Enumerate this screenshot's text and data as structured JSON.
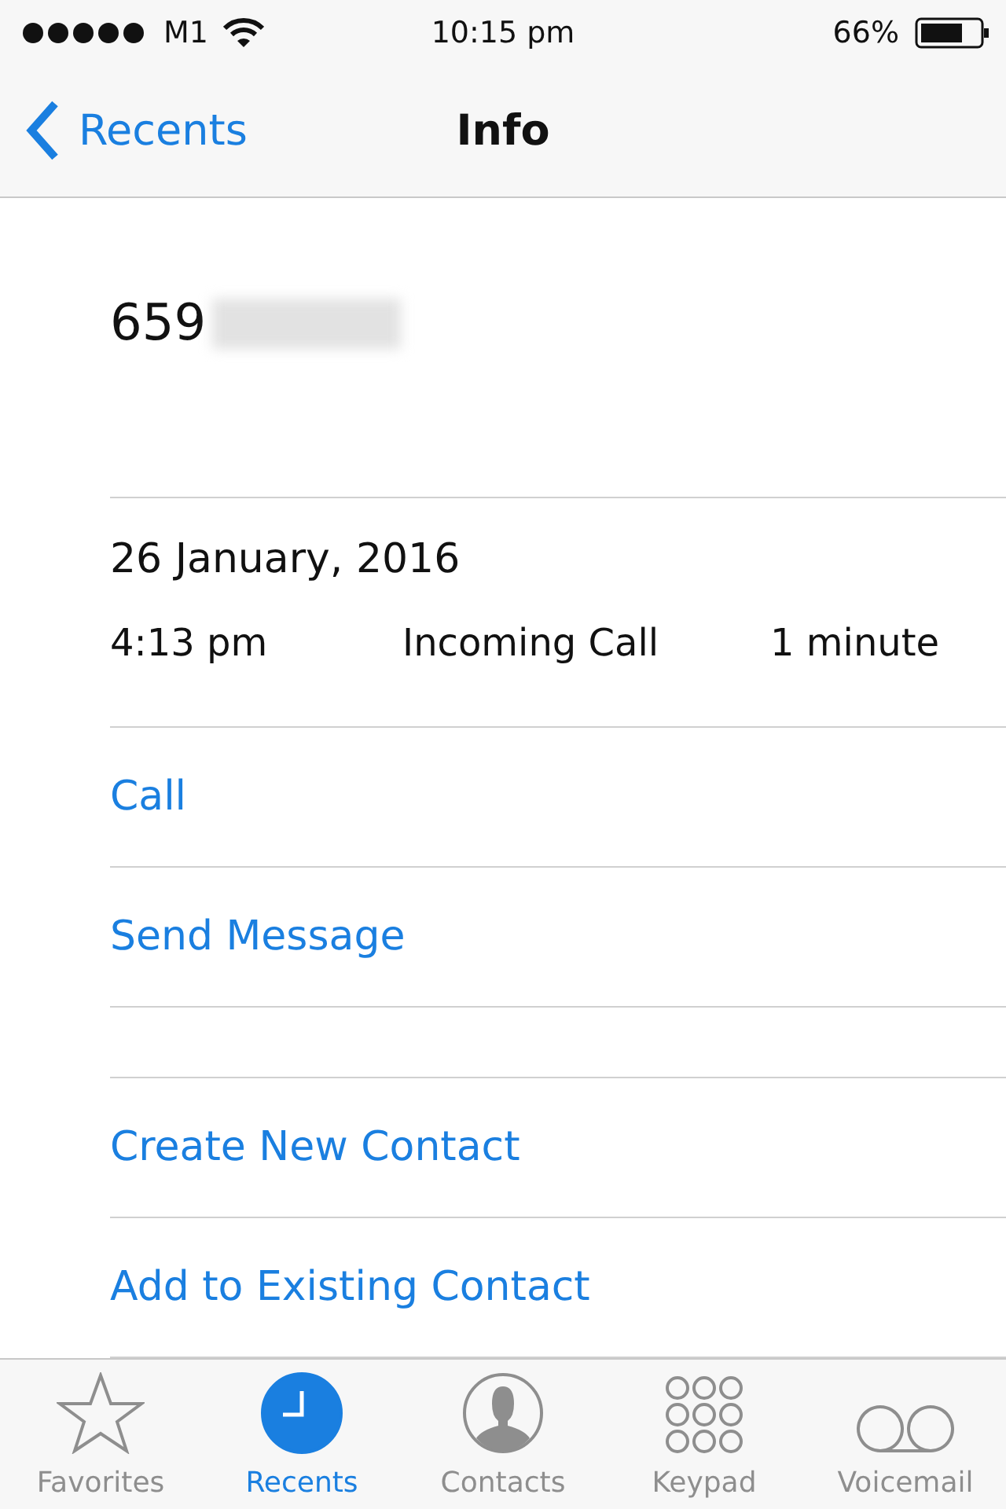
{
  "status_bar": {
    "carrier": "M1",
    "time": "10:15 pm",
    "battery": "66%"
  },
  "nav": {
    "back": "Recents",
    "title": "Info"
  },
  "caller": {
    "number": "659"
  },
  "call_details": {
    "date": "26 January, 2016",
    "entries": [
      {
        "time": "4:13 pm",
        "type": "Incoming Call",
        "duration": "1 minute"
      }
    ]
  },
  "actions": [
    {
      "label": "Call"
    },
    {
      "label": "Send Message"
    }
  ],
  "contact_actions": [
    {
      "label": "Create New Contact"
    },
    {
      "label": "Add to Existing Contact"
    }
  ],
  "tabs": [
    {
      "kind": "favorites",
      "label": "Favorites",
      "selected": false
    },
    {
      "kind": "recents",
      "label": "Recents",
      "selected": true
    },
    {
      "kind": "contacts",
      "label": "Contacts",
      "selected": false
    },
    {
      "kind": "keypad",
      "label": "Keypad",
      "selected": false
    },
    {
      "kind": "voicemail",
      "label": "Voicemail",
      "selected": false
    }
  ]
}
